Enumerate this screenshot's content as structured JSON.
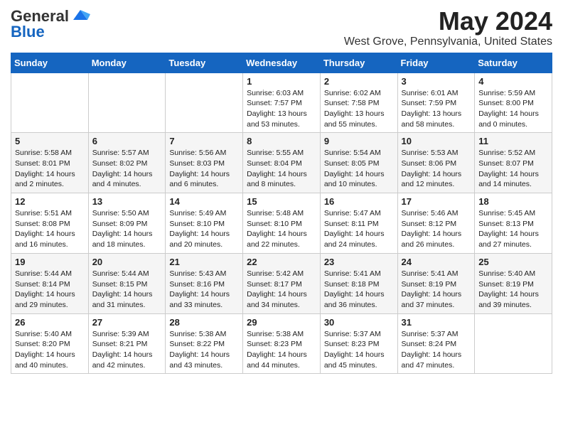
{
  "logo": {
    "line1": "General",
    "line2": "Blue"
  },
  "title": "May 2024",
  "subtitle": "West Grove, Pennsylvania, United States",
  "days_of_week": [
    "Sunday",
    "Monday",
    "Tuesday",
    "Wednesday",
    "Thursday",
    "Friday",
    "Saturday"
  ],
  "weeks": [
    [
      {
        "day": "",
        "content": ""
      },
      {
        "day": "",
        "content": ""
      },
      {
        "day": "",
        "content": ""
      },
      {
        "day": "1",
        "content": "Sunrise: 6:03 AM\nSunset: 7:57 PM\nDaylight: 13 hours and 53 minutes."
      },
      {
        "day": "2",
        "content": "Sunrise: 6:02 AM\nSunset: 7:58 PM\nDaylight: 13 hours and 55 minutes."
      },
      {
        "day": "3",
        "content": "Sunrise: 6:01 AM\nSunset: 7:59 PM\nDaylight: 13 hours and 58 minutes."
      },
      {
        "day": "4",
        "content": "Sunrise: 5:59 AM\nSunset: 8:00 PM\nDaylight: 14 hours and 0 minutes."
      }
    ],
    [
      {
        "day": "5",
        "content": "Sunrise: 5:58 AM\nSunset: 8:01 PM\nDaylight: 14 hours and 2 minutes."
      },
      {
        "day": "6",
        "content": "Sunrise: 5:57 AM\nSunset: 8:02 PM\nDaylight: 14 hours and 4 minutes."
      },
      {
        "day": "7",
        "content": "Sunrise: 5:56 AM\nSunset: 8:03 PM\nDaylight: 14 hours and 6 minutes."
      },
      {
        "day": "8",
        "content": "Sunrise: 5:55 AM\nSunset: 8:04 PM\nDaylight: 14 hours and 8 minutes."
      },
      {
        "day": "9",
        "content": "Sunrise: 5:54 AM\nSunset: 8:05 PM\nDaylight: 14 hours and 10 minutes."
      },
      {
        "day": "10",
        "content": "Sunrise: 5:53 AM\nSunset: 8:06 PM\nDaylight: 14 hours and 12 minutes."
      },
      {
        "day": "11",
        "content": "Sunrise: 5:52 AM\nSunset: 8:07 PM\nDaylight: 14 hours and 14 minutes."
      }
    ],
    [
      {
        "day": "12",
        "content": "Sunrise: 5:51 AM\nSunset: 8:08 PM\nDaylight: 14 hours and 16 minutes."
      },
      {
        "day": "13",
        "content": "Sunrise: 5:50 AM\nSunset: 8:09 PM\nDaylight: 14 hours and 18 minutes."
      },
      {
        "day": "14",
        "content": "Sunrise: 5:49 AM\nSunset: 8:10 PM\nDaylight: 14 hours and 20 minutes."
      },
      {
        "day": "15",
        "content": "Sunrise: 5:48 AM\nSunset: 8:10 PM\nDaylight: 14 hours and 22 minutes."
      },
      {
        "day": "16",
        "content": "Sunrise: 5:47 AM\nSunset: 8:11 PM\nDaylight: 14 hours and 24 minutes."
      },
      {
        "day": "17",
        "content": "Sunrise: 5:46 AM\nSunset: 8:12 PM\nDaylight: 14 hours and 26 minutes."
      },
      {
        "day": "18",
        "content": "Sunrise: 5:45 AM\nSunset: 8:13 PM\nDaylight: 14 hours and 27 minutes."
      }
    ],
    [
      {
        "day": "19",
        "content": "Sunrise: 5:44 AM\nSunset: 8:14 PM\nDaylight: 14 hours and 29 minutes."
      },
      {
        "day": "20",
        "content": "Sunrise: 5:44 AM\nSunset: 8:15 PM\nDaylight: 14 hours and 31 minutes."
      },
      {
        "day": "21",
        "content": "Sunrise: 5:43 AM\nSunset: 8:16 PM\nDaylight: 14 hours and 33 minutes."
      },
      {
        "day": "22",
        "content": "Sunrise: 5:42 AM\nSunset: 8:17 PM\nDaylight: 14 hours and 34 minutes."
      },
      {
        "day": "23",
        "content": "Sunrise: 5:41 AM\nSunset: 8:18 PM\nDaylight: 14 hours and 36 minutes."
      },
      {
        "day": "24",
        "content": "Sunrise: 5:41 AM\nSunset: 8:19 PM\nDaylight: 14 hours and 37 minutes."
      },
      {
        "day": "25",
        "content": "Sunrise: 5:40 AM\nSunset: 8:19 PM\nDaylight: 14 hours and 39 minutes."
      }
    ],
    [
      {
        "day": "26",
        "content": "Sunrise: 5:40 AM\nSunset: 8:20 PM\nDaylight: 14 hours and 40 minutes."
      },
      {
        "day": "27",
        "content": "Sunrise: 5:39 AM\nSunset: 8:21 PM\nDaylight: 14 hours and 42 minutes."
      },
      {
        "day": "28",
        "content": "Sunrise: 5:38 AM\nSunset: 8:22 PM\nDaylight: 14 hours and 43 minutes."
      },
      {
        "day": "29",
        "content": "Sunrise: 5:38 AM\nSunset: 8:23 PM\nDaylight: 14 hours and 44 minutes."
      },
      {
        "day": "30",
        "content": "Sunrise: 5:37 AM\nSunset: 8:23 PM\nDaylight: 14 hours and 45 minutes."
      },
      {
        "day": "31",
        "content": "Sunrise: 5:37 AM\nSunset: 8:24 PM\nDaylight: 14 hours and 47 minutes."
      },
      {
        "day": "",
        "content": ""
      }
    ]
  ]
}
